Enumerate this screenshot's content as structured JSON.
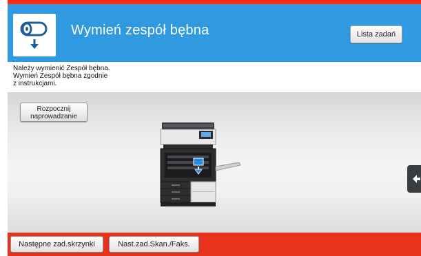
{
  "header": {
    "title": "Wymień zespół bębna",
    "icon": "drum-unit-icon",
    "job_list_label": "Lista zadań",
    "color": "#2f9ae0"
  },
  "message": {
    "lines": [
      "Należy wymienić Zespół bębna.",
      "Wymień Zespół bębna zgodnie",
      "z instrukcjami."
    ]
  },
  "guidance": {
    "label_line1": "Rozpocznij",
    "label_line2": "naprowadzanie"
  },
  "side_tab": {
    "icon": "arrow-left-icon"
  },
  "bottom_bar": {
    "color": "#e8321c",
    "buttons": [
      {
        "label": "Następne zad.skrzynki"
      },
      {
        "label": "Nast.zad.Skan./Faks."
      }
    ]
  },
  "illustration": {
    "icon": "printer-open-door-icon",
    "accent_color": "#1e8fe0"
  }
}
